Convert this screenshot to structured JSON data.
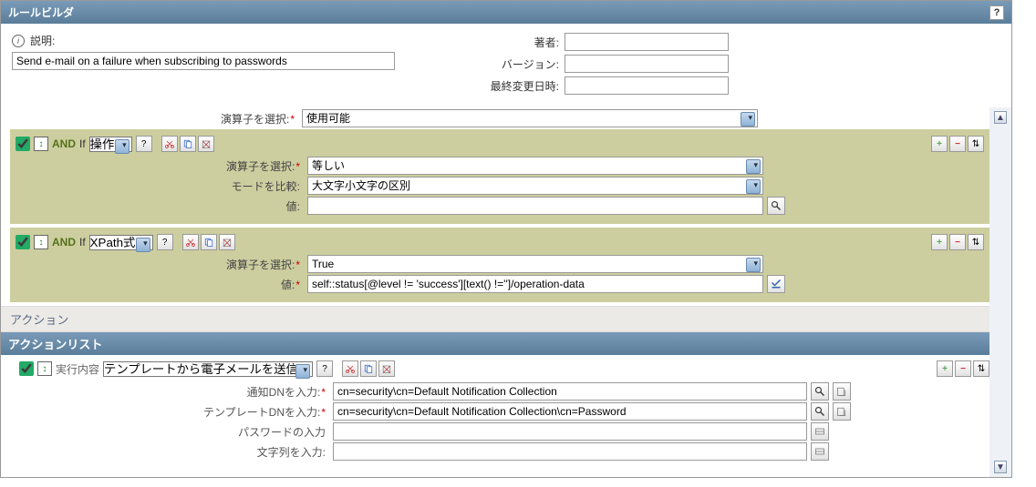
{
  "title": "ルールビルダ",
  "help_label": "?",
  "meta": {
    "description_label": "説明:",
    "description_value": "Send e-mail on a failure when subscribing to passwords",
    "author_label": "著者:",
    "author_value": "",
    "version_label": "バージョン:",
    "version_value": "",
    "modified_label": "最終変更日時:",
    "modified_value": ""
  },
  "operator_select_label": "演算子を選択:",
  "top_operator_value": "使用可能",
  "cond1": {
    "bool": "AND",
    "if": "If",
    "type": "操作",
    "operator_label": "演算子を選択:",
    "operator_value": "等しい",
    "mode_label": "モードを比較:",
    "mode_value": "大文字小文字の区別",
    "value_label": "値:",
    "value_value": ""
  },
  "cond2": {
    "bool": "AND",
    "if": "If",
    "type": "XPath式",
    "operator_label": "演算子を選択:",
    "operator_value": "True",
    "value_label": "値:",
    "value_value": "self::status[@level != 'success'][text() !='']/operation-data"
  },
  "action_section": "アクション",
  "action_list_header": "アクションリスト",
  "action": {
    "execute_label": "実行内容",
    "execute_value": "テンプレートから電子メールを送信",
    "dn_label": "通知DNを入力:",
    "dn_value": "cn=security\\cn=Default Notification Collection",
    "template_dn_label": "テンプレートDNを入力:",
    "template_dn_value": "cn=security\\cn=Default Notification Collection\\cn=Password",
    "password_label": "パスワードの入力",
    "password_value": "",
    "string_label": "文字列を入力:",
    "string_value": ""
  }
}
